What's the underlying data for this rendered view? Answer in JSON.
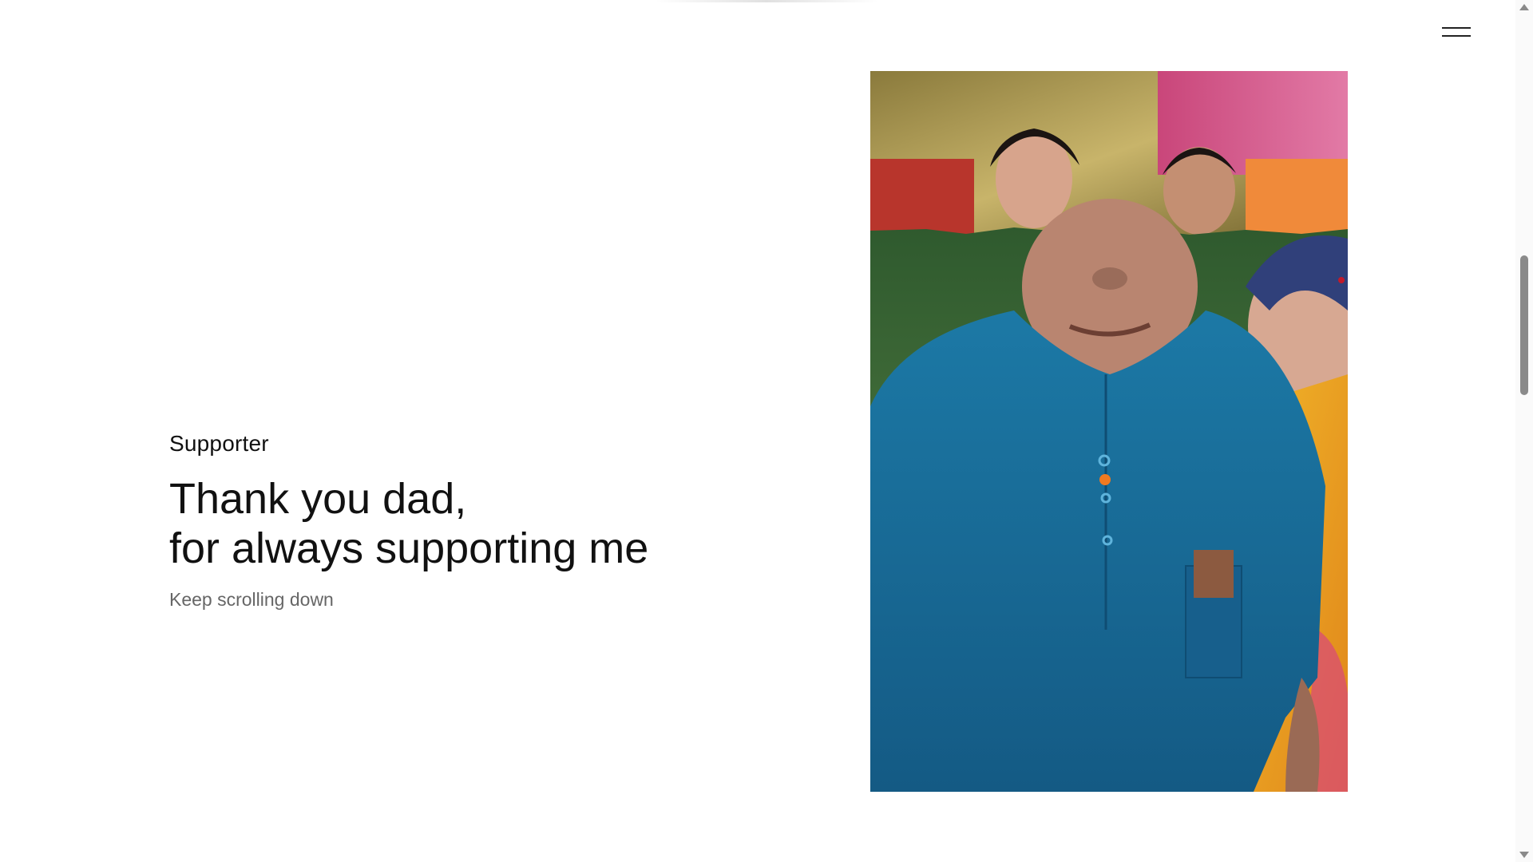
{
  "header": {
    "menu_icon": "hamburger-menu-icon"
  },
  "hero": {
    "eyebrow": "Supporter",
    "headline_line1": "Thank you dad,",
    "headline_line2": "for always supporting me",
    "hint": "Keep scrolling down"
  },
  "photo": {
    "alt": "Collage photo of family members"
  },
  "scrollbar": {
    "up_icon": "scroll-up-arrow-icon",
    "down_icon": "scroll-down-arrow-icon"
  }
}
